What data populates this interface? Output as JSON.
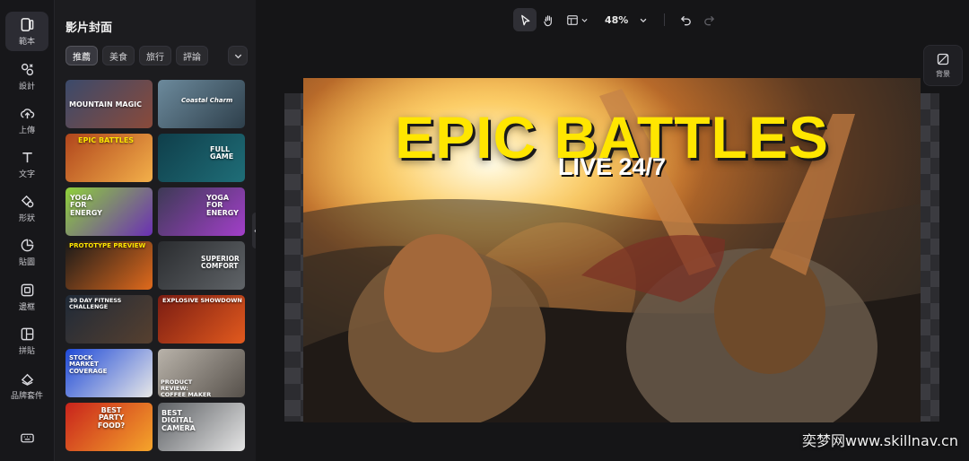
{
  "rail": {
    "items": [
      {
        "label": "範本",
        "icon": "template-icon"
      },
      {
        "label": "設計",
        "icon": "design-icon"
      },
      {
        "label": "上傳",
        "icon": "upload-icon"
      },
      {
        "label": "文字",
        "icon": "text-icon"
      },
      {
        "label": "形狀",
        "icon": "shapes-icon"
      },
      {
        "label": "貼圖",
        "icon": "sticker-icon"
      },
      {
        "label": "邊框",
        "icon": "frame-icon"
      },
      {
        "label": "拼貼",
        "icon": "collage-icon"
      },
      {
        "label": "品牌套件",
        "icon": "brand-kit-icon"
      }
    ],
    "bottom_icon": "keyboard-icon"
  },
  "panel": {
    "title": "影片封面",
    "chips": [
      "推薦",
      "美食",
      "旅行",
      "評論"
    ],
    "thumbnails": [
      {
        "text": "MOUNTAIN MAGIC",
        "colors": [
          "#3b4a6b",
          "#8a4a3a"
        ]
      },
      {
        "text": "Coastal Charm",
        "colors": [
          "#6c8a9c",
          "#2e3f4b"
        ]
      },
      {
        "text": "EPIC BATTLES",
        "colors": [
          "#b0451c",
          "#f3b04a"
        ]
      },
      {
        "text": "FULL GAME",
        "colors": [
          "#0f3e4a",
          "#1f6e78"
        ]
      },
      {
        "text": "YOGA FOR ENERGY",
        "colors": [
          "#8fd13a",
          "#6b2fb5"
        ]
      },
      {
        "text": "YOGA FOR ENERGY",
        "colors": [
          "#3d3a55",
          "#a23fc9"
        ]
      },
      {
        "text": "PROTOTYPE PREVIEW",
        "colors": [
          "#1a1a1a",
          "#e06a1c"
        ]
      },
      {
        "text": "SUPERIOR COMFORT",
        "colors": [
          "#2a2c2f",
          "#606468"
        ]
      },
      {
        "text": "30 DAY FITNESS CHALLENGE",
        "colors": [
          "#1f2a38",
          "#57402f"
        ]
      },
      {
        "text": "EXPLOSIVE SHOWDOWN",
        "colors": [
          "#7a1c12",
          "#e25a1e"
        ]
      },
      {
        "text": "STOCK MARKET COVERAGE",
        "colors": [
          "#1f4ad8",
          "#e7e7e7"
        ]
      },
      {
        "text": "PRODUCT REVIEW: COFFEE MAKER",
        "colors": [
          "#b9b3aa",
          "#56504a"
        ]
      },
      {
        "text": "BEST PARTY FOOD?",
        "colors": [
          "#c8231c",
          "#f5a52b"
        ]
      },
      {
        "text": "BEST DIGITAL CAMERA",
        "colors": [
          "#5c5f63",
          "#e5e5e5"
        ]
      }
    ]
  },
  "toolbar": {
    "zoom": "48%",
    "icons": [
      "select-pointer-icon",
      "hand-pan-icon",
      "layout-icon",
      "undo-icon",
      "redo-icon"
    ]
  },
  "background_button": {
    "label": "背景"
  },
  "canvas": {
    "title": "EPIC BATTLES",
    "subtitle": "LIVE 24/7",
    "accent": "#ffe600"
  },
  "watermark": "奕梦网www.skillnav.cn"
}
